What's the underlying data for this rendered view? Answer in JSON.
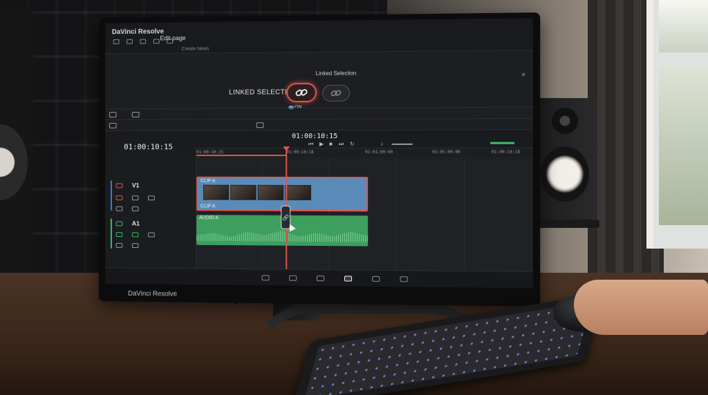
{
  "app": {
    "title": "DaVinci Resolve",
    "page": "Edit page",
    "subtitle": "Create News",
    "brand_footer": "DaVinci Resolve"
  },
  "panel": {
    "title": "Linked Selection",
    "label": "LINKED SELECTION",
    "toggle_state": "ON",
    "close": "✕"
  },
  "transport": {
    "timecode": "01:00:10:15"
  },
  "timeline": {
    "timecode": "01:00:10:15",
    "ruler": [
      "01:00:10:15",
      "01:00:10:18",
      "01:01:00:00",
      "01:05:00:00",
      "01:00:10:18"
    ]
  },
  "tracks": {
    "video": {
      "name": "V1",
      "clip_top": "CLIP A",
      "clip_bottom": "CLIP A"
    },
    "audio": {
      "name": "A1",
      "clip": "AUDIO A"
    }
  },
  "colors": {
    "accent_red": "#e0564b",
    "video_clip": "#5a8bb8",
    "audio_clip": "#3e9e5e",
    "toggle_on": "#5fa8d8"
  },
  "icons": {
    "linked_on": "link-icon",
    "linked_off": "link-icon",
    "play": "play-icon"
  }
}
